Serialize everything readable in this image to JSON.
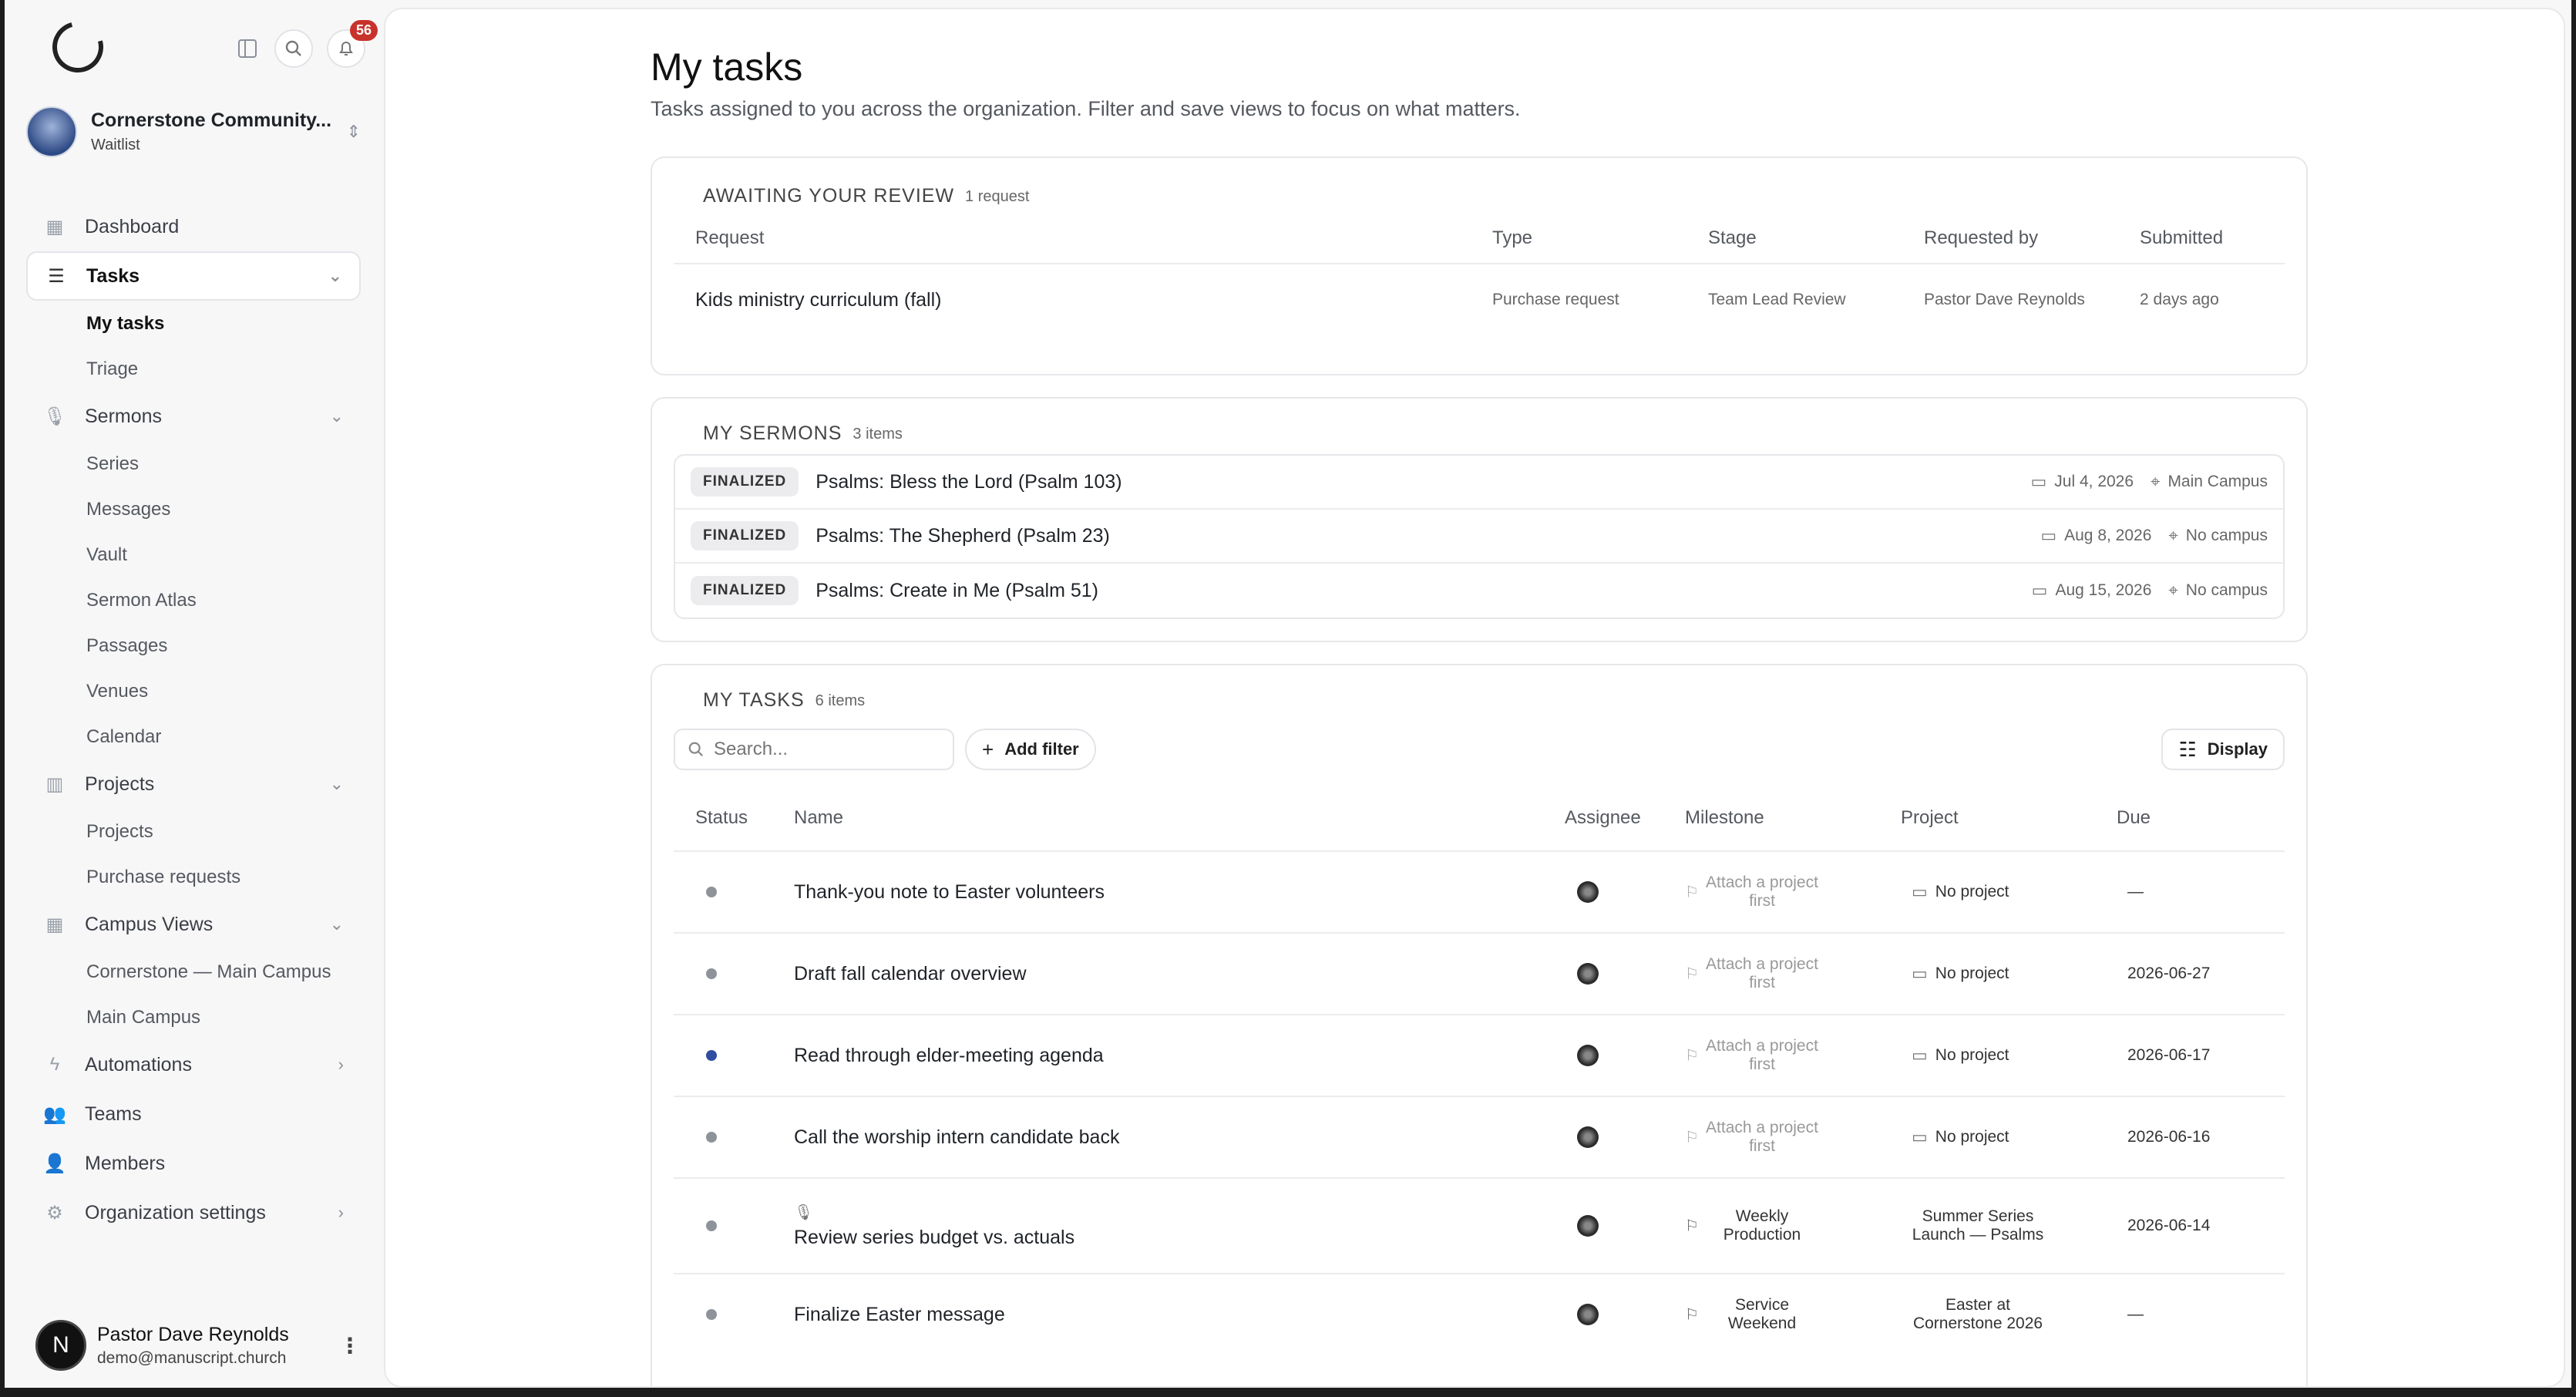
{
  "header": {
    "notifications": "56"
  },
  "org": {
    "name": "Cornerstone Community...",
    "plan": "Waitlist"
  },
  "sidebar": {
    "dashboard": "Dashboard",
    "tasks": "Tasks",
    "tasks_sub": [
      "My tasks",
      "Triage"
    ],
    "sermons": "Sermons",
    "sermons_sub": [
      "Series",
      "Messages",
      "Vault",
      "Sermon Atlas",
      "Passages",
      "Venues",
      "Calendar"
    ],
    "projects": "Projects",
    "projects_sub": [
      "Projects",
      "Purchase requests"
    ],
    "campus": "Campus Views",
    "campus_sub": [
      "Cornerstone — Main Campus",
      "Main Campus"
    ],
    "automations": "Automations",
    "teams": "Teams",
    "members": "Members",
    "org_settings": "Organization settings"
  },
  "user": {
    "initial": "N",
    "name": "Pastor Dave Reynolds",
    "email": "demo@manuscript.church"
  },
  "page": {
    "title": "My tasks",
    "subtitle": "Tasks assigned to you across the organization. Filter and save views to focus on what matters."
  },
  "review": {
    "title": "AWAITING YOUR REVIEW",
    "count": "1 request",
    "columns": [
      "Request",
      "Type",
      "Stage",
      "Requested by",
      "Submitted"
    ],
    "rows": [
      {
        "request": "Kids ministry curriculum (fall)",
        "type": "Purchase request",
        "stage": "Team Lead Review",
        "requested_by": "Pastor Dave Reynolds",
        "submitted": "2 days ago"
      }
    ]
  },
  "sermons": {
    "title": "MY SERMONS",
    "count": "3 items",
    "rows": [
      {
        "status": "FINALIZED",
        "title": "Psalms: Bless the Lord (Psalm 103)",
        "date": "Jul 4, 2026",
        "campus": "Main Campus"
      },
      {
        "status": "FINALIZED",
        "title": "Psalms: The Shepherd (Psalm 23)",
        "date": "Aug 8, 2026",
        "campus": "No campus"
      },
      {
        "status": "FINALIZED",
        "title": "Psalms: Create in Me (Psalm 51)",
        "date": "Aug 15, 2026",
        "campus": "No campus"
      }
    ]
  },
  "tasks": {
    "title": "MY TASKS",
    "count": "6 items",
    "search_placeholder": "Search...",
    "add_filter": "Add filter",
    "display": "Display",
    "columns": [
      "Status",
      "Name",
      "Assignee",
      "Milestone",
      "Project",
      "Due"
    ],
    "rows": [
      {
        "name": "Thank-you note to Easter volunteers",
        "milestone": "Attach a project first",
        "project": "No project",
        "due": "—"
      },
      {
        "name": "Draft fall calendar overview",
        "milestone": "Attach a project first",
        "project": "No project",
        "due": "2026-06-27"
      },
      {
        "name": "Read through elder-meeting agenda",
        "milestone": "Attach a project first",
        "project": "No project",
        "due": "2026-06-17"
      },
      {
        "name": "Call the worship intern candidate back",
        "milestone": "Attach a project first",
        "project": "No project",
        "due": "2026-06-16"
      },
      {
        "name": "Review series budget vs. actuals",
        "milestone": "Weekly Production",
        "project": "Summer Series Launch — Psalms",
        "due": "2026-06-14"
      },
      {
        "name": "Finalize Easter message",
        "milestone": "Service Weekend",
        "project": "Easter at Cornerstone 2026",
        "due": "—"
      }
    ]
  }
}
